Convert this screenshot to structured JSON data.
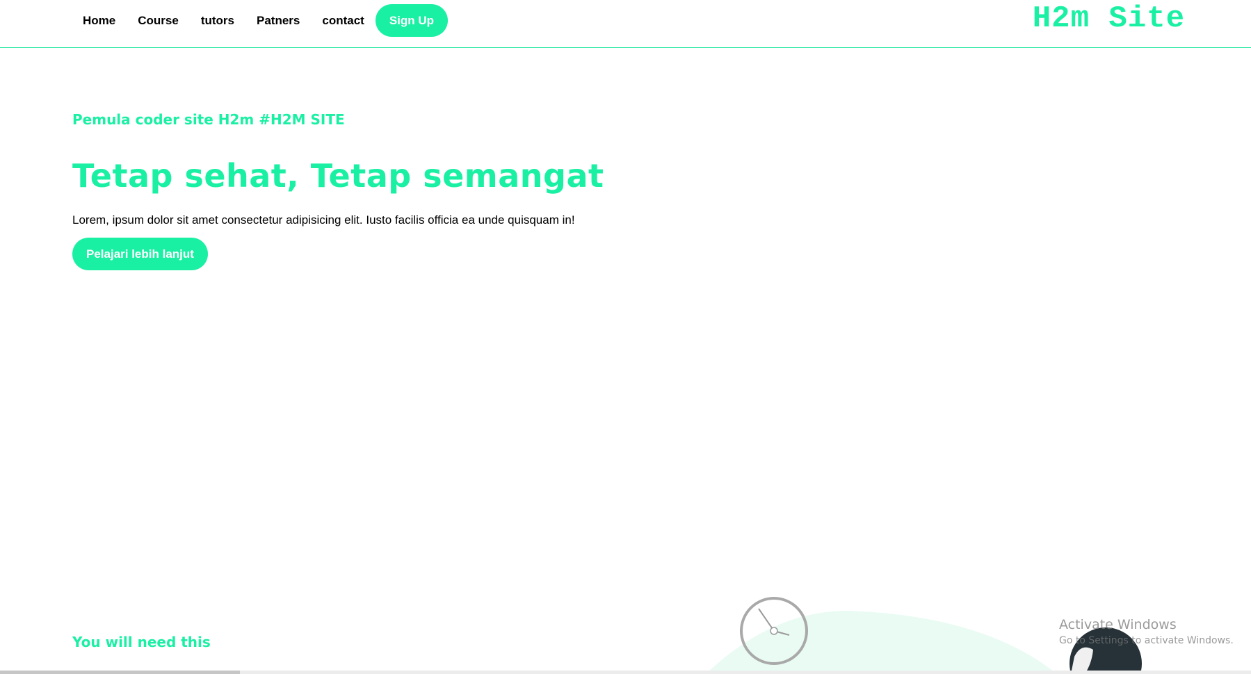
{
  "nav": {
    "items": [
      {
        "label": "Home"
      },
      {
        "label": "Course"
      },
      {
        "label": "tutors"
      },
      {
        "label": "Patners"
      },
      {
        "label": "contact"
      }
    ],
    "signup_label": "Sign Up"
  },
  "brand": "H2m Site",
  "hero": {
    "subtitle": "Pemula coder site H2m #H2M SITE",
    "title": "Tetap sehat, Tetap semangat",
    "description": "Lorem, ipsum dolor sit amet consectetur adipisicing elit. Iusto facilis officia ea unde quisquam in!",
    "cta_label": "Pelajari lebih lanjut"
  },
  "section": {
    "title": "You will need this"
  },
  "watermark": {
    "title": "Activate Windows",
    "subtitle": "Go to Settings to activate Windows."
  },
  "colors": {
    "accent": "#1af0a4",
    "header_border": "#2de8a6",
    "text": "#000000",
    "background": "#ffffff"
  },
  "icons": {
    "clock": "clock-icon",
    "person": "person-head-illustration"
  }
}
